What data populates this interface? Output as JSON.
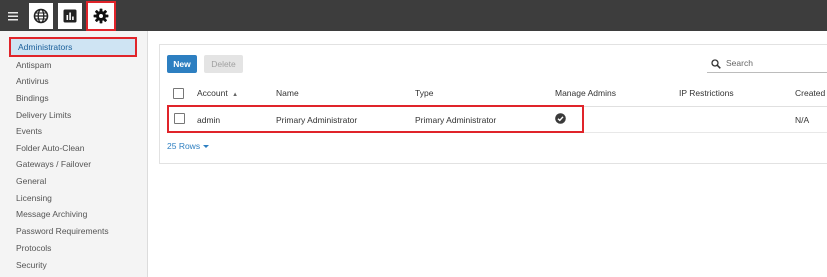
{
  "toolbar": {
    "icons": [
      "menu-icon",
      "globe-icon",
      "bar-chart-icon",
      "gear-icon"
    ]
  },
  "sidebar": {
    "items": [
      {
        "label": "Administrators",
        "active": true
      },
      {
        "label": "Antispam"
      },
      {
        "label": "Antivirus"
      },
      {
        "label": "Bindings"
      },
      {
        "label": "Delivery Limits"
      },
      {
        "label": "Events"
      },
      {
        "label": "Folder Auto-Clean"
      },
      {
        "label": "Gateways / Failover"
      },
      {
        "label": "General"
      },
      {
        "label": "Licensing"
      },
      {
        "label": "Message Archiving"
      },
      {
        "label": "Password Requirements"
      },
      {
        "label": "Protocols"
      },
      {
        "label": "Security"
      }
    ]
  },
  "actions": {
    "new_label": "New",
    "delete_label": "Delete"
  },
  "search": {
    "placeholder": "Search"
  },
  "table": {
    "columns": [
      "Account",
      "Name",
      "Type",
      "Manage Admins",
      "IP Restrictions",
      "Created"
    ],
    "sort_indicator": "▲",
    "rows": [
      {
        "account": "admin",
        "name": "Primary Administrator",
        "type": "Primary Administrator",
        "manage_admins": true,
        "ip_restrictions": "",
        "created": "N/A"
      }
    ]
  },
  "pagination": {
    "rows_label": "25 Rows"
  },
  "colors": {
    "accent": "#2d7fc1",
    "highlight": "#e0242a",
    "active_bg": "#cfe4f3",
    "topbar": "#3d3d3d"
  }
}
